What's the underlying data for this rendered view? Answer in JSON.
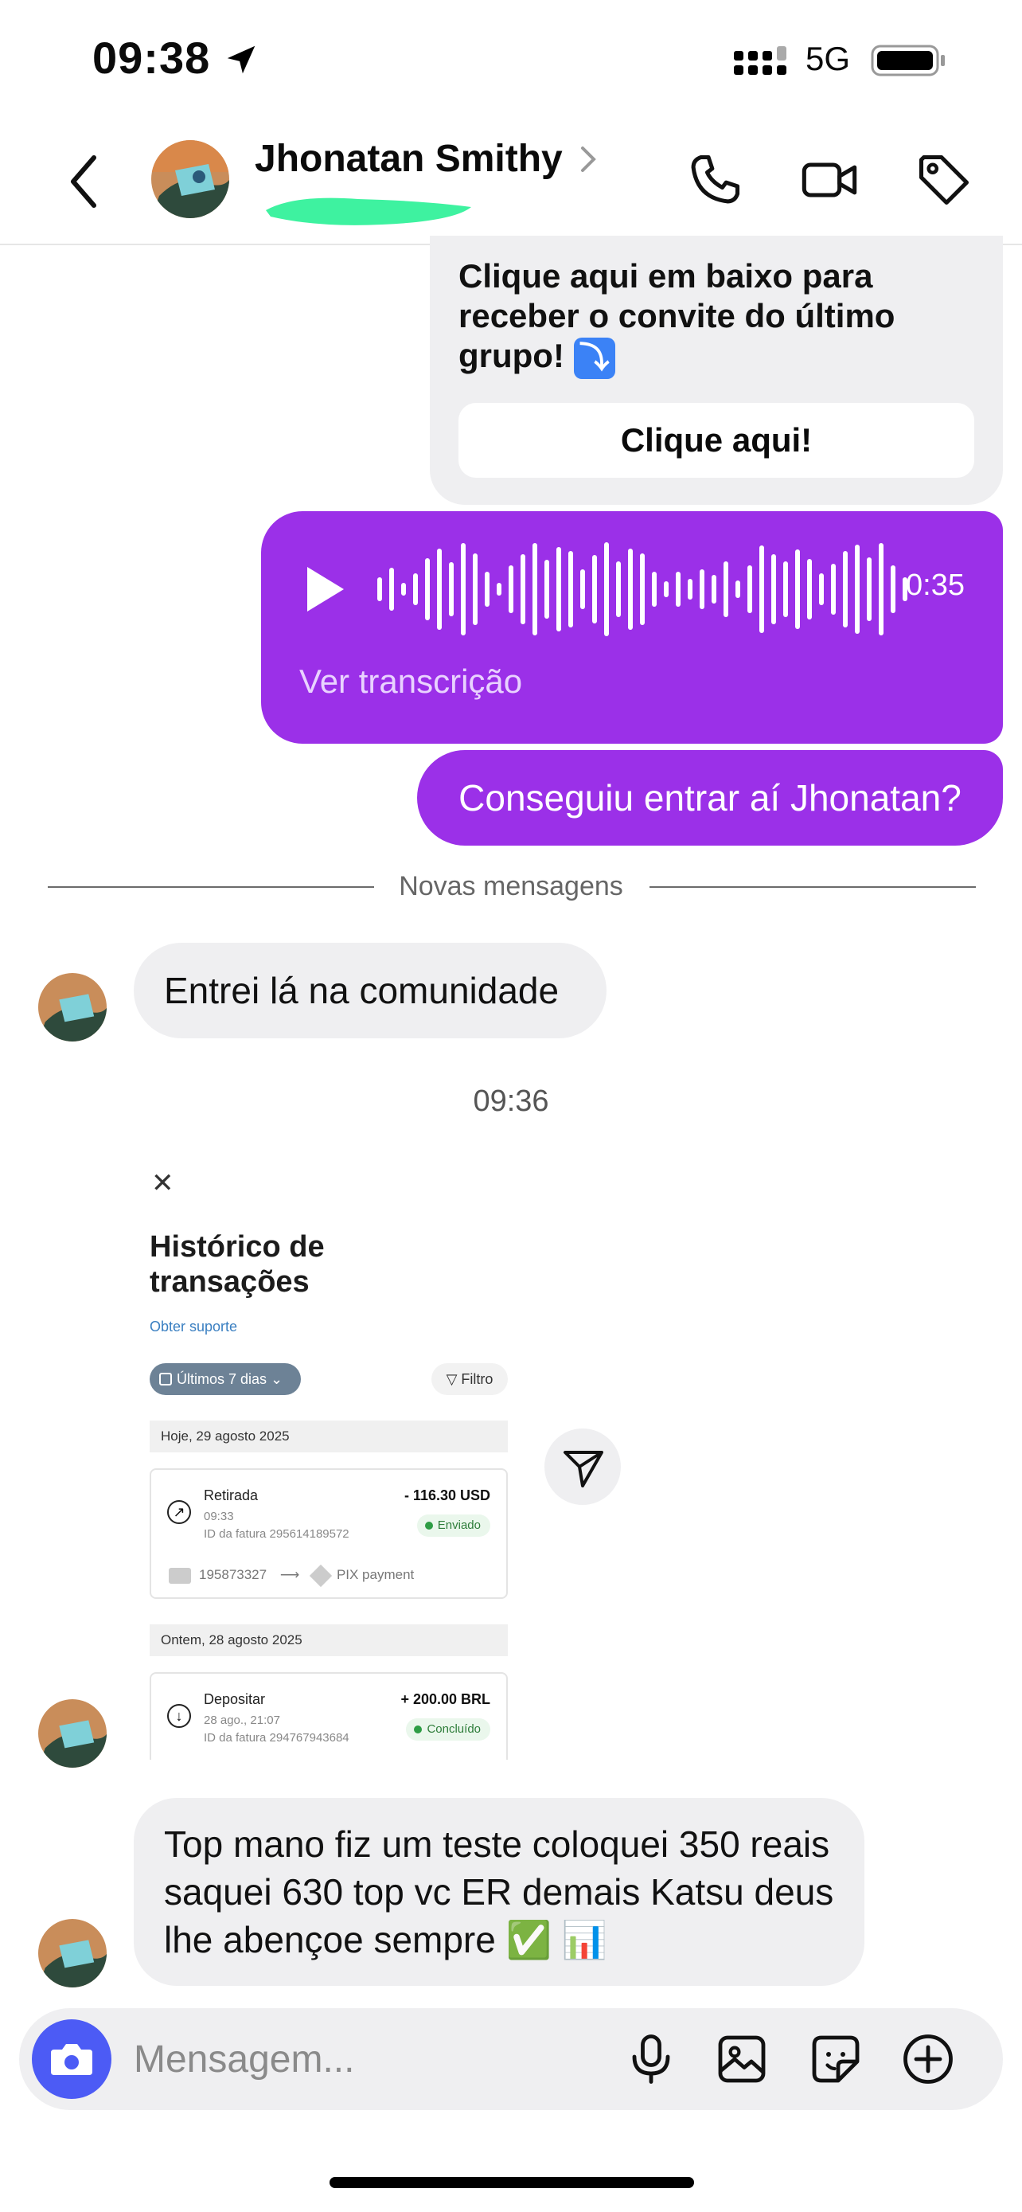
{
  "status_bar": {
    "time": "09:38",
    "network": "5G"
  },
  "header": {
    "contact_name": "Jhonatan Smithy"
  },
  "messages": {
    "card": {
      "text": "Clique aqui em baixo para receber o convite do último grupo!",
      "emoji": "⤵",
      "button_label": "Clique aqui!"
    },
    "voice": {
      "duration": "0:35",
      "transcript_label": "Ver transcrição"
    },
    "sent_text": "Conseguiu entrar aí Jhonatan?",
    "divider_label": "Novas mensagens",
    "received_1": "Entrei lá na comunidade",
    "timestamp": "09:36",
    "received_2": "Top mano fiz um teste coloquei 350 reais saquei 630 top vc ER demais Katsu deus lhe abençoe sempre ✅ 📊"
  },
  "screenshot": {
    "title": "Histórico de transações",
    "support_link": "Obter suporte",
    "range_chip": "Últimos 7 dias",
    "filter_chip": "Filtro",
    "day_1": "Hoje, 29 agosto 2025",
    "tx_1": {
      "type": "Retirada",
      "time": "09:33",
      "id": "ID da fatura 295614189572",
      "amount": "- 116.30 USD",
      "status": "Enviado",
      "route_from": "195873327",
      "route_to": "PIX payment"
    },
    "day_2": "Ontem, 28 agosto 2025",
    "tx_2": {
      "type": "Depositar",
      "time": "28 ago., 21:07",
      "id": "ID da fatura 294767943684",
      "amount": "+ 200.00 BRL",
      "status": "Concluído"
    }
  },
  "composer": {
    "placeholder": "Mensagem..."
  },
  "colors": {
    "accent": "#9b30e8",
    "camera": "#4c5bf5",
    "bubble_gray": "#efeff1"
  }
}
